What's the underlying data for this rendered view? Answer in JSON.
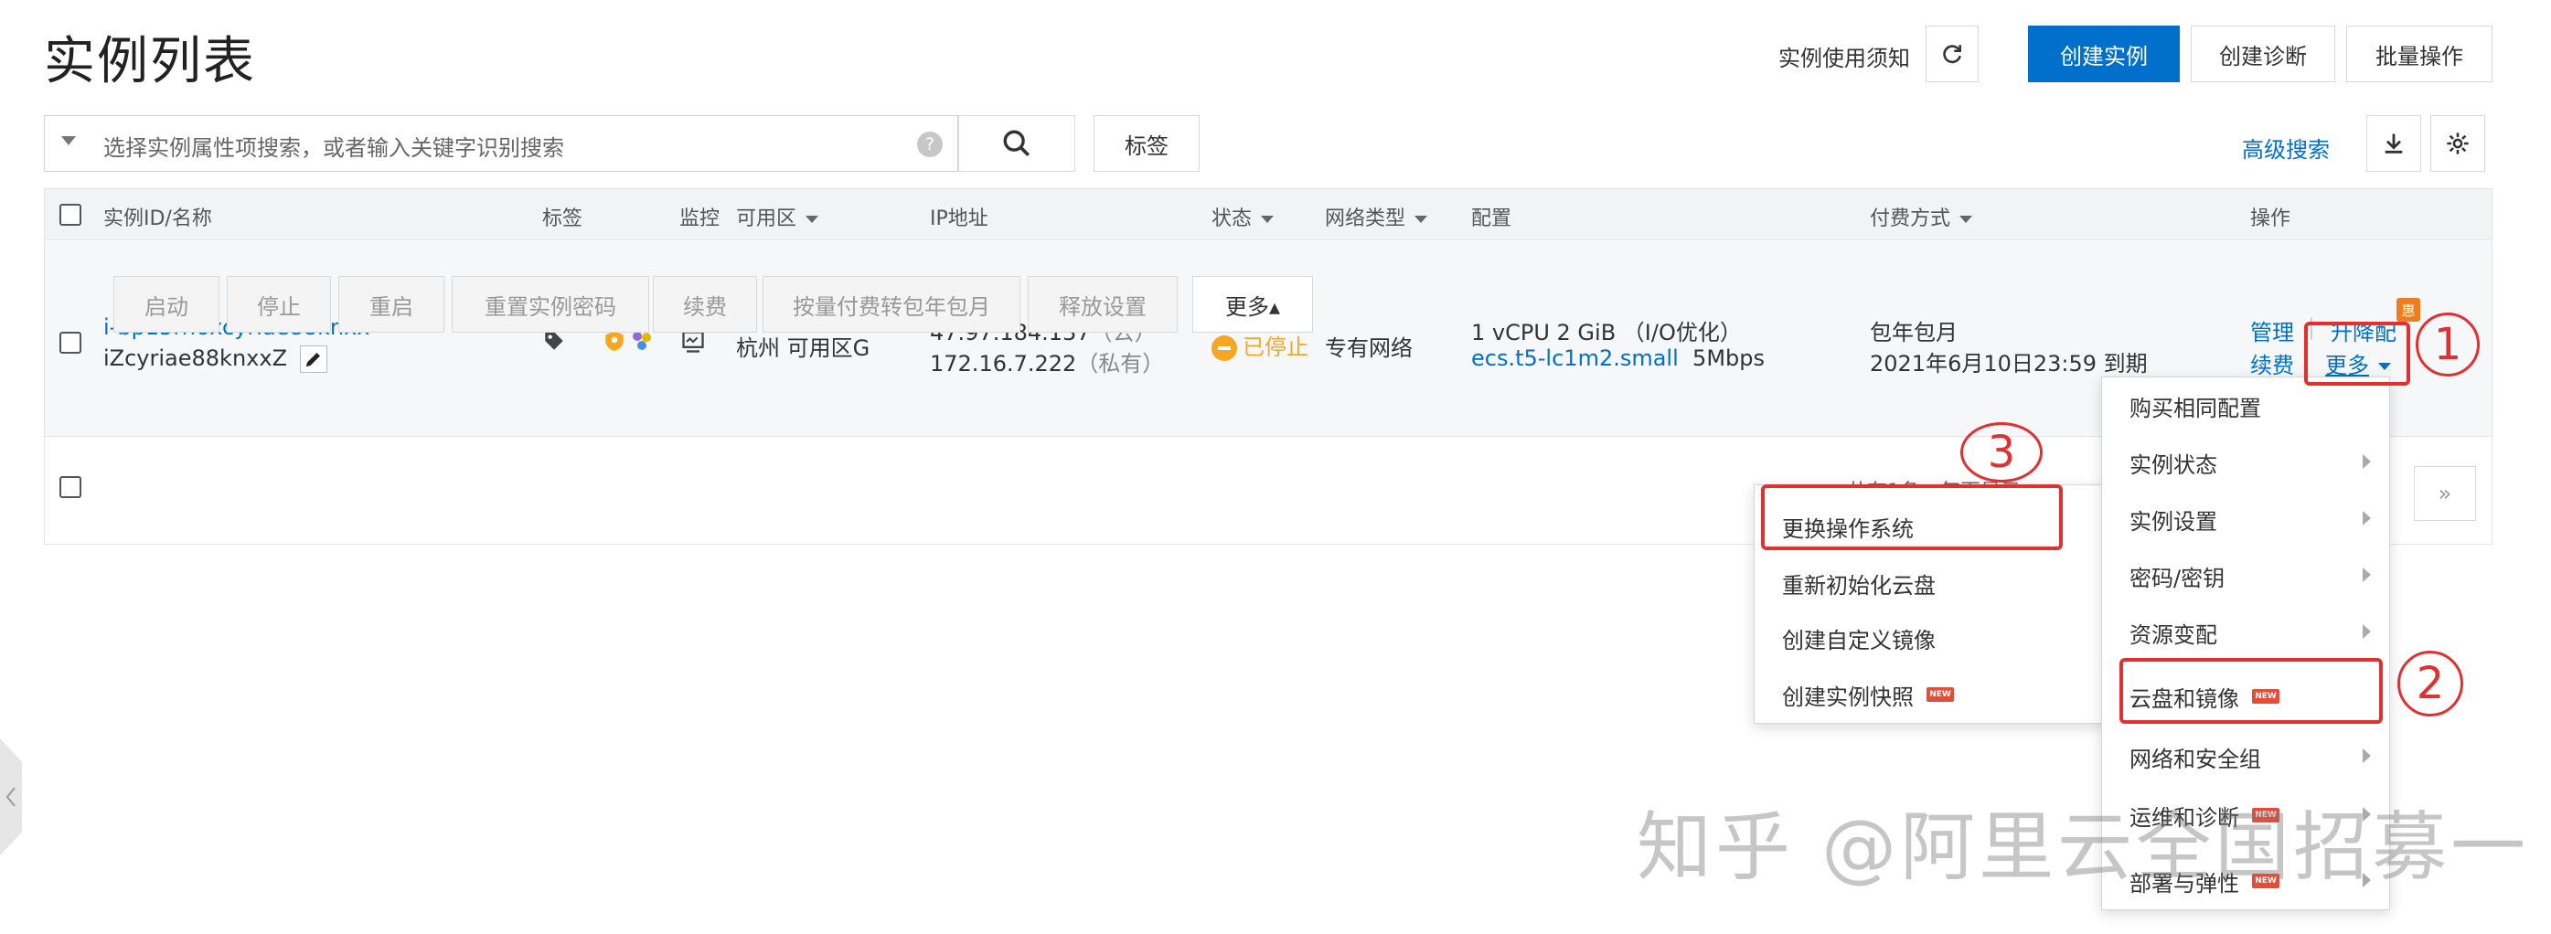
{
  "header": {
    "title": "实例列表",
    "notice_link": "实例使用须知",
    "create_instance": "创建实例",
    "create_diagnosis": "创建诊断",
    "batch_ops": "批量操作"
  },
  "search": {
    "placeholder": "选择实例属性项搜索，或者输入关键字识别搜索",
    "help": "?",
    "tag_button": "标签",
    "advanced": "高级搜索"
  },
  "table": {
    "headers": {
      "id": "实例ID/名称",
      "tag": "标签",
      "monitor": "监控",
      "zone": "可用区",
      "ip": "IP地址",
      "status": "状态",
      "network": "网络类型",
      "config": "配置",
      "billing": "付费方式",
      "ops": "操作"
    },
    "row": {
      "instance_id": "i-bp15rn6xcyriae88knxx",
      "instance_name": "iZcyriae88knxxZ",
      "zone": "杭州 可用区G",
      "ip_public": "47.97.184.137",
      "ip_public_tag": "（公）",
      "ip_private": "172.16.7.222",
      "ip_private_tag": "（私有）",
      "status": "已停止",
      "network": "专有网络",
      "config_line1": "1 vCPU 2 GiB （I/O优化）",
      "config_type": "ecs.t5-lc1m2.small",
      "config_bw": "5Mbps",
      "billing_line1": "包年包月",
      "billing_line2": "2021年6月10日23:59 到期",
      "op_manage": "管理",
      "op_upgrade": "升降配",
      "op_renew": "续费",
      "op_more": "更多",
      "badge": "惠"
    }
  },
  "bottom": {
    "start": "启动",
    "stop": "停止",
    "restart": "重启",
    "reset_pwd": "重置实例密码",
    "renew": "续费",
    "convert": "按量付费转包年包月",
    "release": "释放设置",
    "more": "更多▴",
    "pagination_text": "共有1条，每页显示",
    "next_page": "»"
  },
  "menu_main": {
    "items": [
      {
        "label": "购买相同配置"
      },
      {
        "label": "实例状态"
      },
      {
        "label": "实例设置"
      },
      {
        "label": "密码/密钥"
      },
      {
        "label": "资源变配"
      },
      {
        "label": "云盘和镜像"
      },
      {
        "label": "网络和安全组"
      },
      {
        "label": "运维和诊断"
      },
      {
        "label": "部署与弹性"
      }
    ]
  },
  "menu_sub": {
    "items": [
      {
        "label": "更换操作系统"
      },
      {
        "label": "重新初始化云盘"
      },
      {
        "label": "创建自定义镜像"
      },
      {
        "label": "创建实例快照"
      }
    ]
  },
  "badges": {
    "new": "NEW"
  },
  "annotations": {
    "one": "1",
    "two": "2",
    "three": "3"
  },
  "watermark": "知乎 @阿里云全国招募一",
  "colors": {
    "primary": "#0070cc",
    "annotation": "#e03030",
    "stopped": "#f5a623",
    "new_badge": "#e34d3a"
  }
}
